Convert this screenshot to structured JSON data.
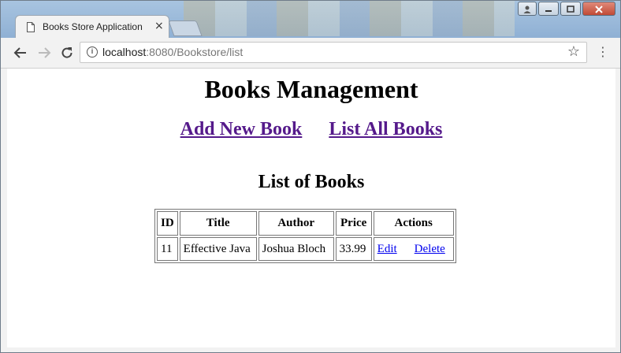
{
  "browser": {
    "tab_title": "Books Store Application",
    "tab_close": "×",
    "url_host": "localhost",
    "url_path": ":8080/Bookstore/list",
    "icons": [
      "page-icon",
      "back-icon",
      "forward-icon",
      "reload-icon",
      "info-icon",
      "star-icon",
      "menu-icon"
    ]
  },
  "page": {
    "title": "Books Management",
    "links": {
      "add": "Add New Book",
      "list": "List All Books"
    },
    "table_caption": "List of Books",
    "columns": [
      "ID",
      "Title",
      "Author",
      "Price",
      "Actions"
    ],
    "rows": [
      {
        "id": "11",
        "title": "Effective Java",
        "author": "Joshua Bloch",
        "price": "33.99",
        "edit": "Edit",
        "delete": "Delete"
      }
    ]
  },
  "colors": {
    "visited_link": "#551a8b",
    "link": "#0000ee",
    "close_button": "#c14a35"
  }
}
